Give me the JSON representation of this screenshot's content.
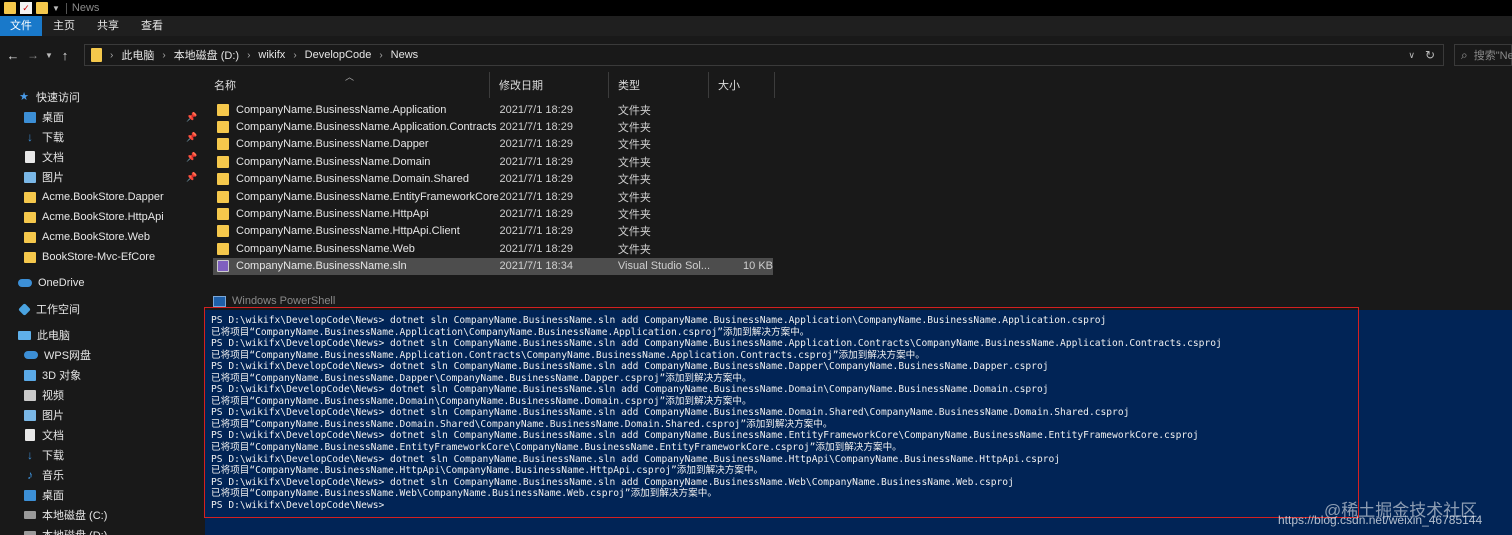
{
  "window": {
    "title": "News"
  },
  "ribbon": {
    "tabs": [
      "文件",
      "主页",
      "共享",
      "查看"
    ]
  },
  "address": {
    "crumbs": [
      "此电脑",
      "本地磁盘 (D:)",
      "wikifx",
      "DevelopCode",
      "News"
    ]
  },
  "search": {
    "placeholder": "搜索\"News\""
  },
  "nav": {
    "items": [
      {
        "label": "快速访问",
        "icon": "star-icon",
        "pinned": false
      },
      {
        "label": "桌面",
        "icon": "desktop-icon",
        "pinned": true
      },
      {
        "label": "下载",
        "icon": "download-icon",
        "pinned": true
      },
      {
        "label": "文档",
        "icon": "document-icon",
        "pinned": true
      },
      {
        "label": "图片",
        "icon": "picture-icon",
        "pinned": true
      },
      {
        "label": "Acme.BookStore.Dapper",
        "icon": "folder-icon",
        "pinned": false
      },
      {
        "label": "Acme.BookStore.HttpApi",
        "icon": "folder-icon",
        "pinned": false
      },
      {
        "label": "Acme.BookStore.Web",
        "icon": "folder-icon",
        "pinned": false
      },
      {
        "label": "BookStore-Mvc-EfCore",
        "icon": "folder-icon",
        "pinned": false
      },
      {
        "label": "OneDrive",
        "icon": "cloud-icon",
        "pinned": false
      },
      {
        "label": "工作空间",
        "icon": "network-icon",
        "pinned": false
      },
      {
        "label": "此电脑",
        "icon": "computer-icon",
        "pinned": false
      },
      {
        "label": "WPS网盘",
        "icon": "cloud-drive-icon",
        "pinned": false
      },
      {
        "label": "3D 对象",
        "icon": "cube-icon",
        "pinned": false
      },
      {
        "label": "视频",
        "icon": "video-icon",
        "pinned": false
      },
      {
        "label": "图片",
        "icon": "picture-icon",
        "pinned": false
      },
      {
        "label": "文档",
        "icon": "document-icon",
        "pinned": false
      },
      {
        "label": "下载",
        "icon": "download-icon",
        "pinned": false
      },
      {
        "label": "音乐",
        "icon": "music-icon",
        "pinned": false
      },
      {
        "label": "桌面",
        "icon": "desktop-icon",
        "pinned": false
      },
      {
        "label": "本地磁盘 (C:)",
        "icon": "drive-icon",
        "pinned": false
      },
      {
        "label": "本地磁盘 (D:)",
        "icon": "drive-icon",
        "pinned": false
      }
    ]
  },
  "files": {
    "columns": [
      "名称",
      "修改日期",
      "类型",
      "大小"
    ],
    "rows": [
      {
        "name": "CompanyName.BusinessName.Application",
        "date": "2021/7/1 18:29",
        "type": "文件夹",
        "size": ""
      },
      {
        "name": "CompanyName.BusinessName.Application.Contracts",
        "date": "2021/7/1 18:29",
        "type": "文件夹",
        "size": ""
      },
      {
        "name": "CompanyName.BusinessName.Dapper",
        "date": "2021/7/1 18:29",
        "type": "文件夹",
        "size": ""
      },
      {
        "name": "CompanyName.BusinessName.Domain",
        "date": "2021/7/1 18:29",
        "type": "文件夹",
        "size": ""
      },
      {
        "name": "CompanyName.BusinessName.Domain.Shared",
        "date": "2021/7/1 18:29",
        "type": "文件夹",
        "size": ""
      },
      {
        "name": "CompanyName.BusinessName.EntityFrameworkCore",
        "date": "2021/7/1 18:29",
        "type": "文件夹",
        "size": ""
      },
      {
        "name": "CompanyName.BusinessName.HttpApi",
        "date": "2021/7/1 18:29",
        "type": "文件夹",
        "size": ""
      },
      {
        "name": "CompanyName.BusinessName.HttpApi.Client",
        "date": "2021/7/1 18:29",
        "type": "文件夹",
        "size": ""
      },
      {
        "name": "CompanyName.BusinessName.Web",
        "date": "2021/7/1 18:29",
        "type": "文件夹",
        "size": ""
      },
      {
        "name": "CompanyName.BusinessName.sln",
        "date": "2021/7/1 18:34",
        "type": "Visual Studio Sol...",
        "size": "10 KB"
      }
    ]
  },
  "powershell": {
    "title": "Windows PowerShell",
    "lines": [
      "PS D:\\wikifx\\DevelopCode\\News> dotnet sln CompanyName.BusinessName.sln add CompanyName.BusinessName.Application\\CompanyName.BusinessName.Application.csproj",
      "已将项目“CompanyName.BusinessName.Application\\CompanyName.BusinessName.Application.csproj”添加到解决方案中。",
      "PS D:\\wikifx\\DevelopCode\\News> dotnet sln CompanyName.BusinessName.sln add CompanyName.BusinessName.Application.Contracts\\CompanyName.BusinessName.Application.Contracts.csproj",
      "已将项目“CompanyName.BusinessName.Application.Contracts\\CompanyName.BusinessName.Application.Contracts.csproj”添加到解决方案中。",
      "PS D:\\wikifx\\DevelopCode\\News> dotnet sln CompanyName.BusinessName.sln add CompanyName.BusinessName.Dapper\\CompanyName.BusinessName.Dapper.csproj",
      "已将项目“CompanyName.BusinessName.Dapper\\CompanyName.BusinessName.Dapper.csproj”添加到解决方案中。",
      "PS D:\\wikifx\\DevelopCode\\News> dotnet sln CompanyName.BusinessName.sln add CompanyName.BusinessName.Domain\\CompanyName.BusinessName.Domain.csproj",
      "已将项目“CompanyName.BusinessName.Domain\\CompanyName.BusinessName.Domain.csproj”添加到解决方案中。",
      "PS D:\\wikifx\\DevelopCode\\News> dotnet sln CompanyName.BusinessName.sln add CompanyName.BusinessName.Domain.Shared\\CompanyName.BusinessName.Domain.Shared.csproj",
      "已将项目“CompanyName.BusinessName.Domain.Shared\\CompanyName.BusinessName.Domain.Shared.csproj”添加到解决方案中。",
      "PS D:\\wikifx\\DevelopCode\\News> dotnet sln CompanyName.BusinessName.sln add CompanyName.BusinessName.EntityFrameworkCore\\CompanyName.BusinessName.EntityFrameworkCore.csproj",
      "已将项目“CompanyName.BusinessName.EntityFrameworkCore\\CompanyName.BusinessName.EntityFrameworkCore.csproj”添加到解决方案中。",
      "PS D:\\wikifx\\DevelopCode\\News> dotnet sln CompanyName.BusinessName.sln add CompanyName.BusinessName.HttpApi\\CompanyName.BusinessName.HttpApi.csproj",
      "已将项目“CompanyName.BusinessName.HttpApi\\CompanyName.BusinessName.HttpApi.csproj”添加到解决方案中。",
      "PS D:\\wikifx\\DevelopCode\\News> dotnet sln CompanyName.BusinessName.sln add CompanyName.BusinessName.Web\\CompanyName.BusinessName.Web.csproj",
      "已将项目“CompanyName.BusinessName.Web\\CompanyName.BusinessName.Web.csproj”添加到解决方案中。",
      "PS D:\\wikifx\\DevelopCode\\News>"
    ]
  },
  "watermark": {
    "site": "@稀土掘金技术社区",
    "url": "https://blog.csdn.net/weixin_46785144"
  },
  "colors": {
    "accent": "#1979ca",
    "powershell_bg": "#012456",
    "highlight_frame": "#d42020",
    "folder": "#f5c84c"
  }
}
